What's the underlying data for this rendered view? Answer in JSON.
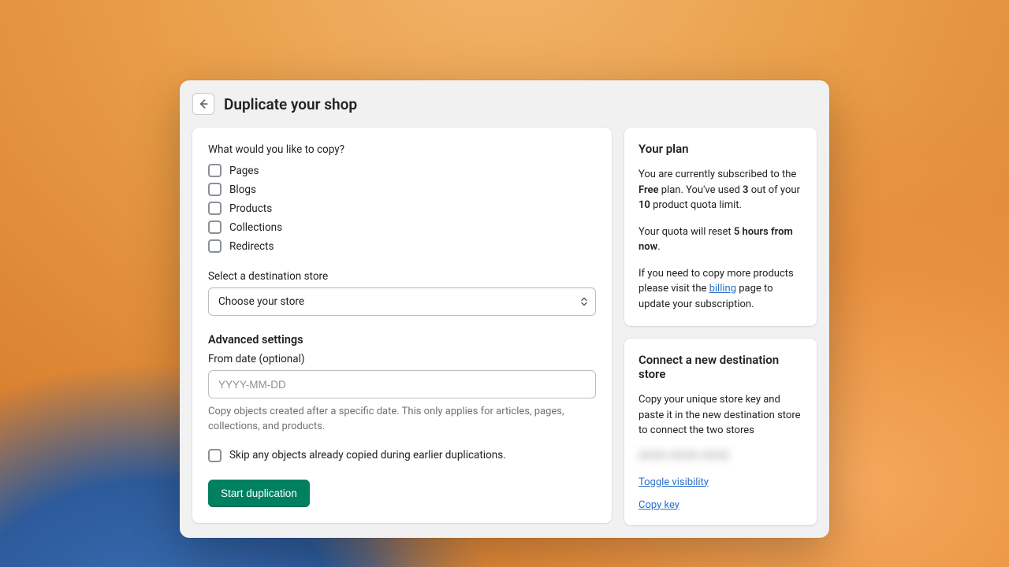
{
  "header": {
    "title": "Duplicate your shop"
  },
  "form": {
    "copy_prompt": "What would you like to copy?",
    "options": {
      "pages": "Pages",
      "blogs": "Blogs",
      "products": "Products",
      "collections": "Collections",
      "redirects": "Redirects"
    },
    "dest_label": "Select a destination store",
    "dest_placeholder": "Choose your store",
    "advanced_heading": "Advanced settings",
    "from_date_label": "From date (optional)",
    "from_date_placeholder": "YYYY-MM-DD",
    "from_date_help": "Copy objects created after a specific date. This only applies for articles, pages, collections, and products.",
    "skip_label": "Skip any objects already copied during earlier duplications.",
    "submit": "Start duplication"
  },
  "plan": {
    "heading": "Your plan",
    "p1_a": "You are currently subscribed to the ",
    "p1_plan": "Free",
    "p1_b": " plan. You've used ",
    "p1_used": "3",
    "p1_c": " out of your ",
    "p1_total": "10",
    "p1_d": " product quota limit.",
    "p2_a": "Your quota will reset ",
    "p2_time": "5 hours from now",
    "p2_b": ".",
    "p3_a": "If you need to copy more products please visit the ",
    "p3_link": "billing",
    "p3_b": " page to update your subscription."
  },
  "connect": {
    "heading": "Connect a new destination store",
    "desc": "Copy your unique store key and paste it in the new destination store to connect the two stores",
    "key_masked": "0000-0000-0000",
    "toggle": "Toggle visibility",
    "copy": "Copy key"
  }
}
